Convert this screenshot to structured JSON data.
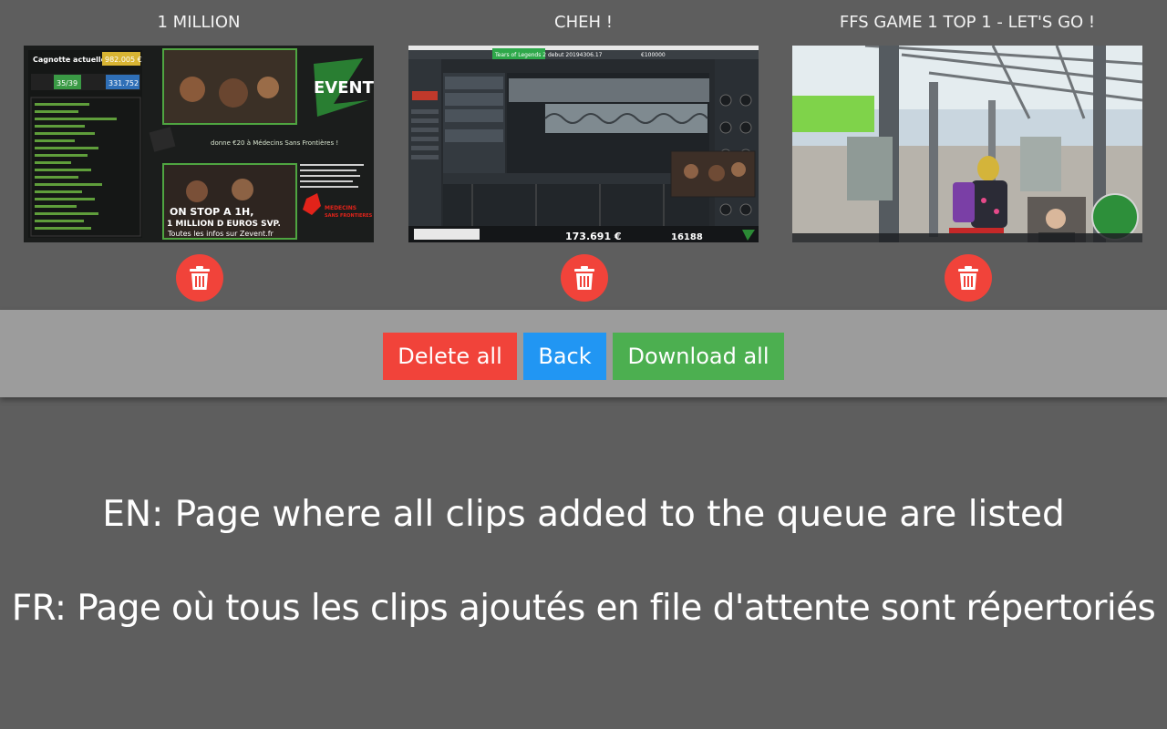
{
  "clips": [
    {
      "title": "1 MILLION",
      "thumbnail": {
        "cagnotte_label": "Cagnotte actuelle :",
        "cagnotte_value": "982.005 €",
        "stat_left": "35/39",
        "stat_right": "331.752",
        "brand": "EVENT",
        "donation_text": "donne €20 à Médecins Sans Frontières !",
        "banner_line1": "ON STOP A 1H,",
        "banner_line2": "1 MILLION D EUROS SVP.",
        "banner_line3": "Toutes les infos sur Zevent.fr",
        "msf_line1": "MEDECINS",
        "msf_line2": "SANS FRONTIERES"
      }
    },
    {
      "title": "CHEH !",
      "thumbnail": {
        "tab_label": "Tears of Legends 2 debut 20194306.17",
        "goal": "€100000",
        "total": "173.691 €",
        "count": "16188"
      }
    },
    {
      "title": "FFS GAME 1 TOP 1 - LET'S GO !",
      "thumbnail": {}
    }
  ],
  "toolbar": {
    "delete_all": "Delete all",
    "back": "Back",
    "download_all": "Download all"
  },
  "captions": {
    "en": "EN: Page where all clips added to the queue are listed",
    "fr": "FR: Page où tous les clips ajoutés en file d'attente sont répertoriés"
  },
  "colors": {
    "background": "#5e5e5e",
    "toolbar": "#9c9c9c",
    "danger": "#f1433a",
    "primary": "#2196f3",
    "success": "#4caf50"
  },
  "icons": {
    "delete": "trash-icon"
  }
}
